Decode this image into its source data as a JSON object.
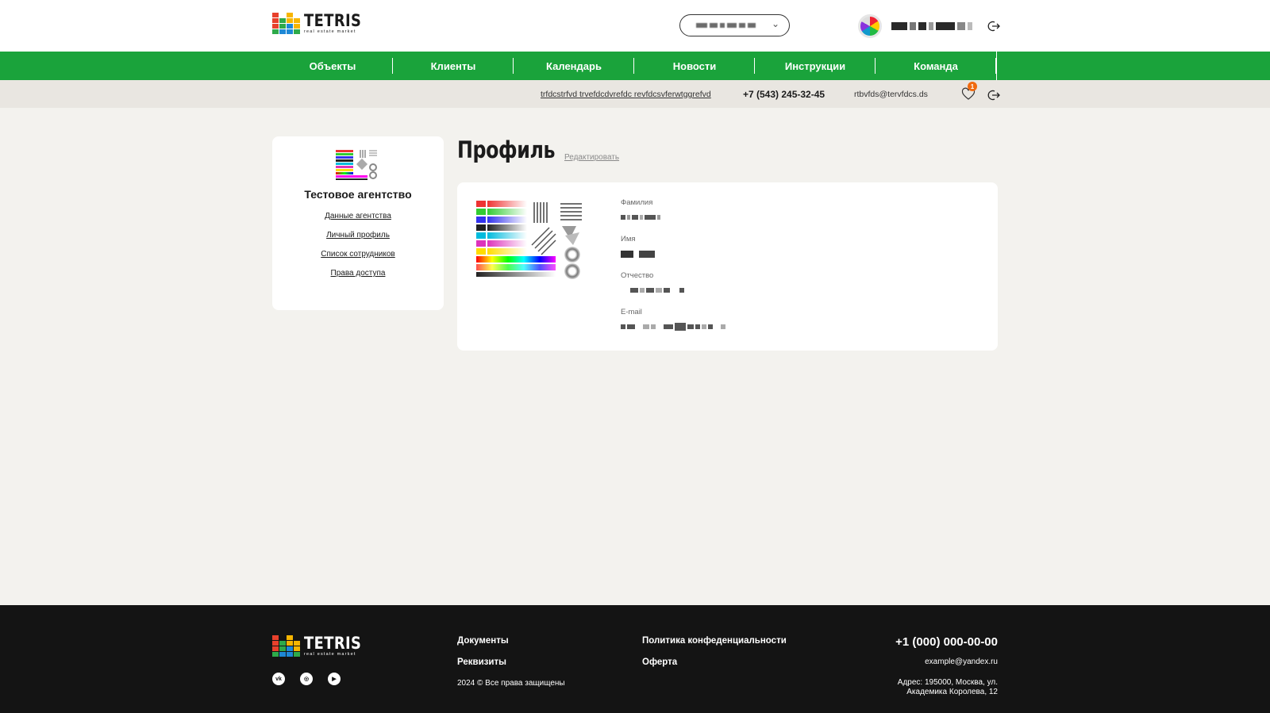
{
  "brand": {
    "name": "TETRIS",
    "tagline": "real estate market"
  },
  "nav": {
    "items": [
      "Объекты",
      "Клиенты",
      "Календарь",
      "Новости",
      "Инструкции",
      "Команда"
    ]
  },
  "infobar": {
    "address": "trfdcstrfvd trvefdcdvrefdc revfdcsvferwtggrefvd",
    "phone": "+7 (543) 245-32-45",
    "email": "rtbvfds@tervfdcs.ds",
    "favorites_count": "1"
  },
  "sidebar": {
    "agency_name": "Тестовое агентство",
    "links": [
      "Данные агентства",
      "Личный профиль",
      "Список сотрудников",
      "Права доступа"
    ]
  },
  "profile": {
    "title": "Профиль",
    "edit_label": "Редактировать",
    "fields": {
      "last_name_label": "Фамилия",
      "first_name_label": "Имя",
      "patronymic_label": "Отчество",
      "email_label": "E-mail"
    }
  },
  "footer": {
    "documents": "Документы",
    "requisites": "Реквизиты",
    "privacy": "Политика конфеденциальности",
    "offer": "Оферта",
    "copyright": "2024 © Все права защищены",
    "phone": "+1 (000) 000-00-00",
    "email": "example@yandex.ru",
    "address_line1": "Адрес: 195000, Москва, ул.",
    "address_line2": "Академика Королева, 12",
    "socials": [
      "vk-icon",
      "instagram-icon",
      "youtube-icon"
    ]
  },
  "colors": {
    "accent_green": "#1aa33b",
    "badge_orange": "#f06a0f",
    "footer_bg": "#141414"
  }
}
